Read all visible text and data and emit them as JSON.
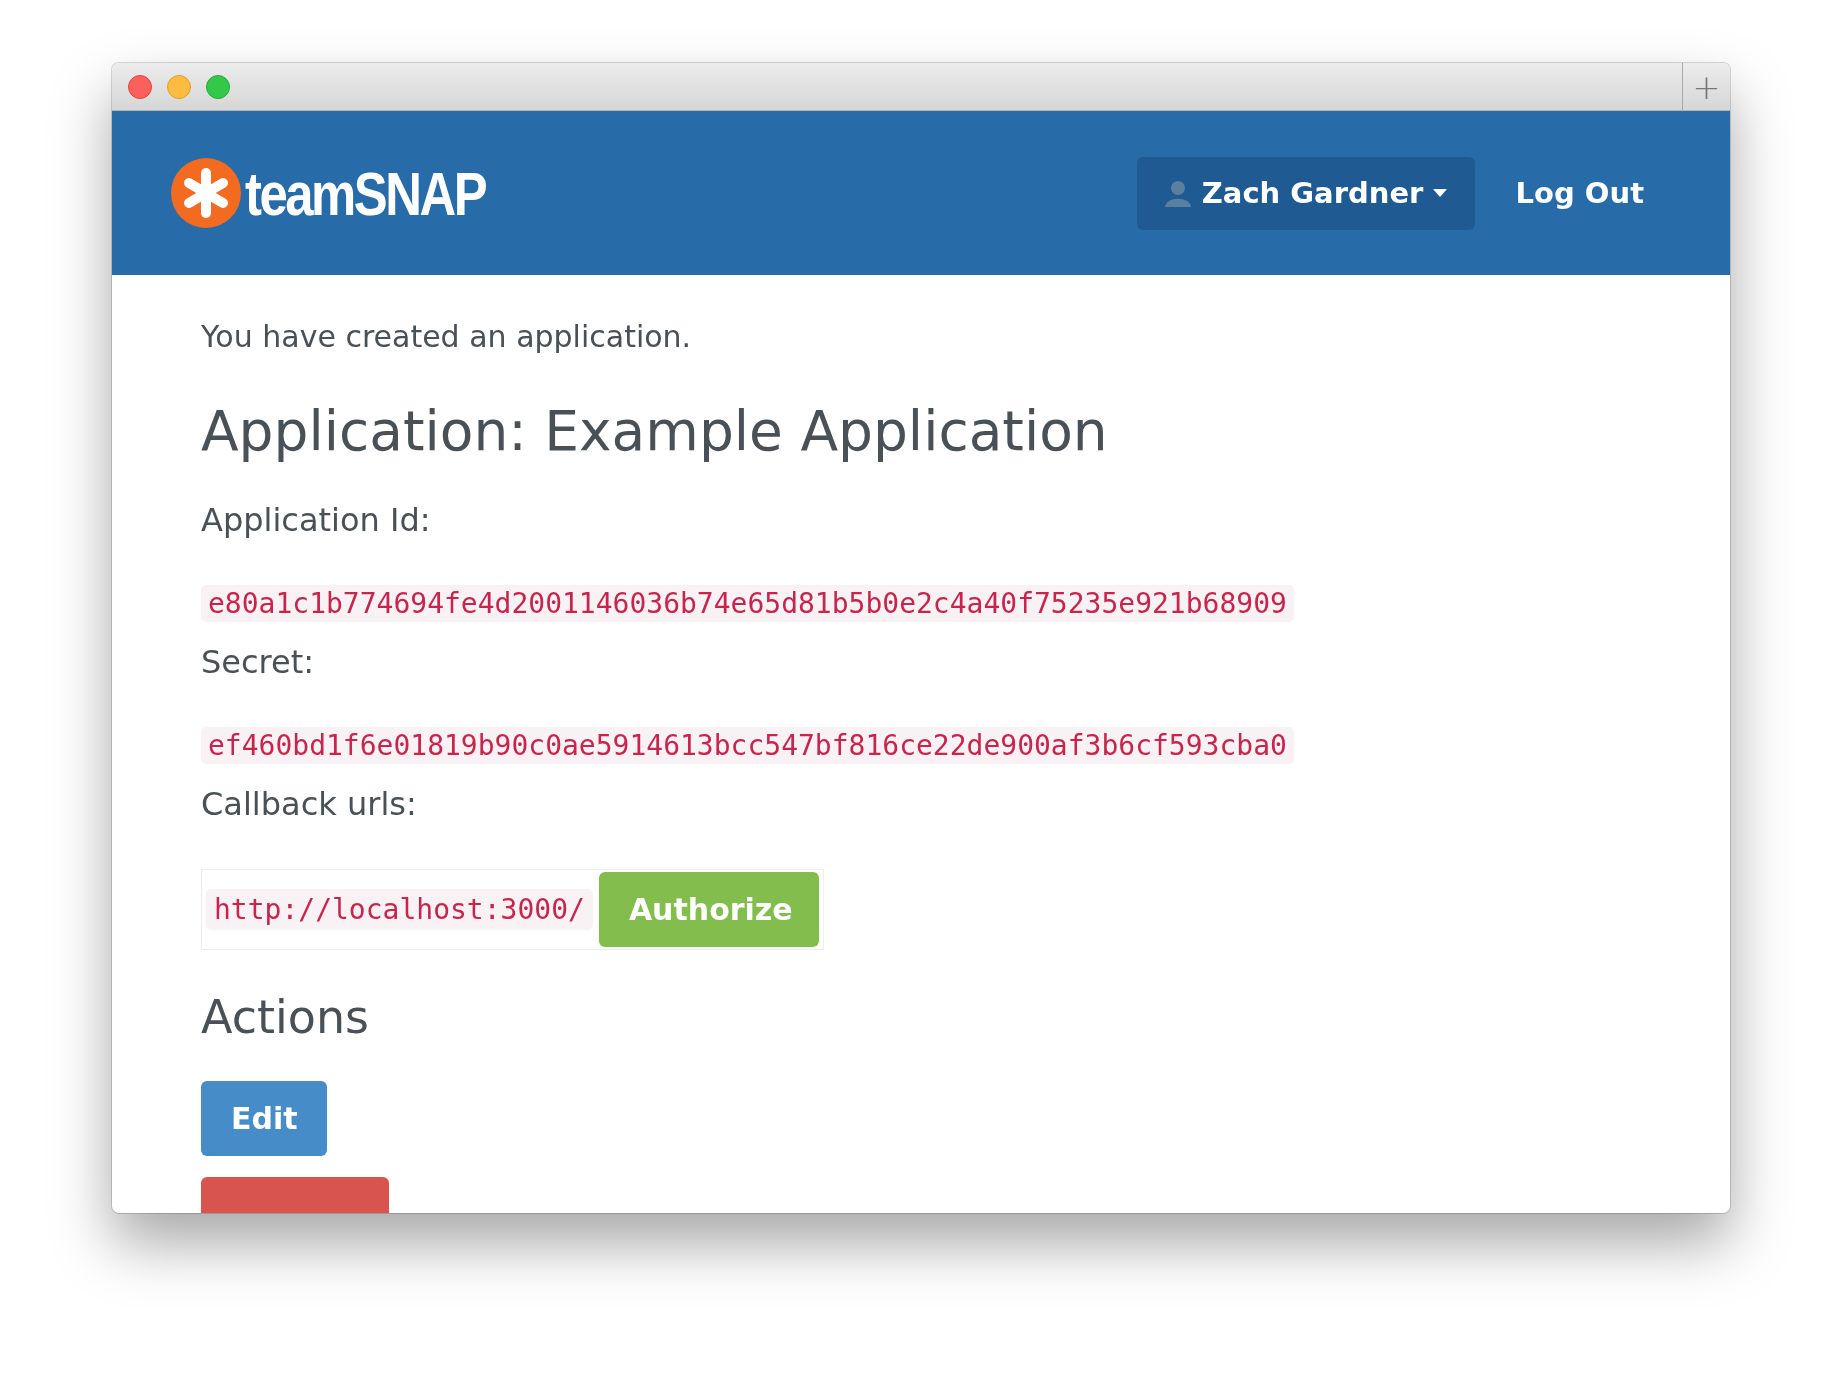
{
  "window": {
    "new_tab_button": "+"
  },
  "header": {
    "logo_text": "teamSNAP",
    "user_menu": "Zach Gardner",
    "logout": "Log Out"
  },
  "notice": "You have created an application.",
  "title": "Application: Example Application",
  "fields": [
    {
      "label": "Application Id:",
      "value": "e80a1c1b774694fe4d2001146036b74e65d81b5b0e2c4a40f75235e921b68909"
    },
    {
      "label": "Secret:",
      "value": "ef460bd1f6e01819b90c0ae5914613bcc547bf816ce22de900af3b6cf593cba0"
    }
  ],
  "callbacks": {
    "label": "Callback urls:",
    "urls": [
      {
        "url": "http://localhost:3000/",
        "button": "Authorize"
      }
    ]
  },
  "actions": {
    "heading": "Actions",
    "buttons": [
      {
        "kind": "edit",
        "label": "Edit"
      },
      {
        "kind": "destroy"
      }
    ]
  }
}
